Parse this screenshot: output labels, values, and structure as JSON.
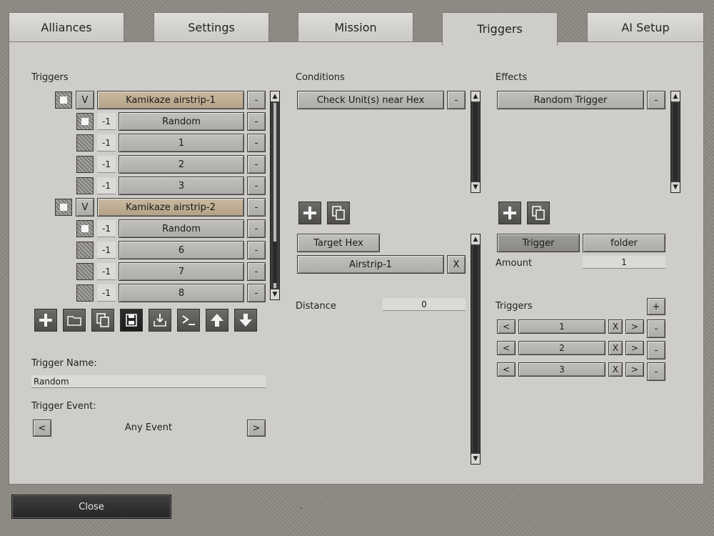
{
  "tabs": [
    "Alliances",
    "Settings",
    "Mission",
    "Triggers",
    "AI Setup"
  ],
  "active_tab": "Triggers",
  "triggers": {
    "label": "Triggers",
    "rows": [
      {
        "kind": "folder",
        "toggle": "V",
        "name": "Kamikaze airstrip-1",
        "remove": "-"
      },
      {
        "kind": "item",
        "num": "-1",
        "name": "Random",
        "remove": "-"
      },
      {
        "kind": "item",
        "num": "-1",
        "name": "1",
        "remove": "-"
      },
      {
        "kind": "item",
        "num": "-1",
        "name": "2",
        "remove": "-"
      },
      {
        "kind": "item",
        "num": "-1",
        "name": "3",
        "remove": "-"
      },
      {
        "kind": "folder",
        "toggle": "V",
        "name": "Kamikaze airstrip-2",
        "remove": "-"
      },
      {
        "kind": "item",
        "num": "-1",
        "name": "Random",
        "remove": "-"
      },
      {
        "kind": "item",
        "num": "-1",
        "name": "6",
        "remove": "-"
      },
      {
        "kind": "item",
        "num": "-1",
        "name": "7",
        "remove": "-"
      },
      {
        "kind": "item",
        "num": "-1",
        "name": "8",
        "remove": "-"
      }
    ],
    "toolbar_icons": [
      "plus-icon",
      "folder-icon",
      "copy-icon",
      "save-icon",
      "import-icon",
      "console-icon",
      "arrow-up-icon",
      "arrow-down-icon"
    ],
    "name_label": "Trigger Name:",
    "name_value": "Random",
    "event_label": "Trigger Event:",
    "event_prev": "<",
    "event_value": "Any Event",
    "event_next": ">"
  },
  "conditions": {
    "label": "Conditions",
    "items": [
      {
        "name": "Check Unit(s) near Hex",
        "remove": "-"
      }
    ],
    "target_hex_label": "Target Hex",
    "target_value": "Airstrip-1",
    "target_clear": "X",
    "distance_label": "Distance",
    "distance_value": "0"
  },
  "effects": {
    "label": "Effects",
    "items": [
      {
        "name": "Random Trigger",
        "remove": "-"
      }
    ],
    "tab_trigger": "Trigger",
    "tab_folder": "folder",
    "amount_label": "Amount",
    "amount_value": "1",
    "triggers_label": "Triggers",
    "add": "+",
    "list": [
      {
        "prev": "<",
        "value": "1",
        "clear": "X",
        "next": ">",
        "remove": "-"
      },
      {
        "prev": "<",
        "value": "2",
        "clear": "X",
        "next": ">",
        "remove": "-"
      },
      {
        "prev": "<",
        "value": "3",
        "clear": "X",
        "next": ">",
        "remove": "-"
      }
    ]
  },
  "bottom": {
    "close": "Close",
    "footer_mark": "-"
  },
  "colors": {
    "panel": "#cfcdc9",
    "button": "#b8b6b2",
    "folder_button": "#c0b093",
    "close_bar": "#2e2e2e"
  }
}
